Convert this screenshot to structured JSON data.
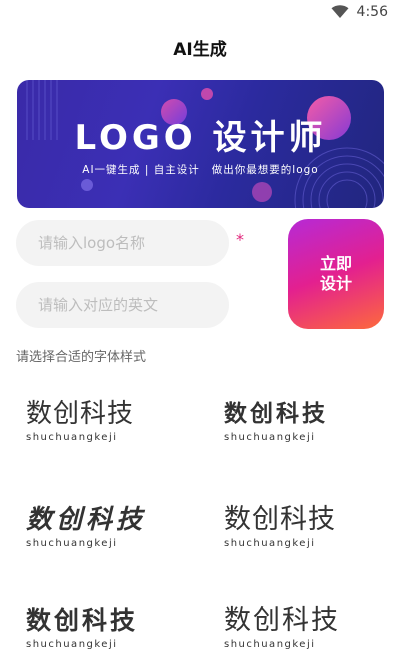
{
  "status_bar": {
    "time": "4:56",
    "wifi_icon": "wifi-icon"
  },
  "header": {
    "title": "AI生成"
  },
  "banner": {
    "headline": "LOGO 设计师",
    "subtitle_left": "AI一键生成 | 自主设计",
    "subtitle_right": "做出你最想要的logo"
  },
  "form": {
    "name_placeholder": "请输入logo名称",
    "name_value": "",
    "english_placeholder": "请输入对应的英文",
    "english_value": "",
    "required_mark": "*",
    "generate_label": "立即设计"
  },
  "font_section": {
    "label": "请选择合适的字体样式"
  },
  "font_options": [
    {
      "sample": "数创科技",
      "pinyin": "shuchuangkeji"
    },
    {
      "sample": "数创科技",
      "pinyin": "shuchuangkeji"
    },
    {
      "sample": "数创科技",
      "pinyin": "shuchuangkeji"
    },
    {
      "sample": "数创科技",
      "pinyin": "shuchuangkeji"
    },
    {
      "sample": "数创科技",
      "pinyin": "shuchuangkeji"
    },
    {
      "sample": "数创科技",
      "pinyin": "shuchuangkeji"
    }
  ],
  "colors": {
    "accent_start": "#b62ad6",
    "accent_end": "#fd6a3c",
    "banner": "#3a2aa8",
    "required": "#e2267b"
  }
}
